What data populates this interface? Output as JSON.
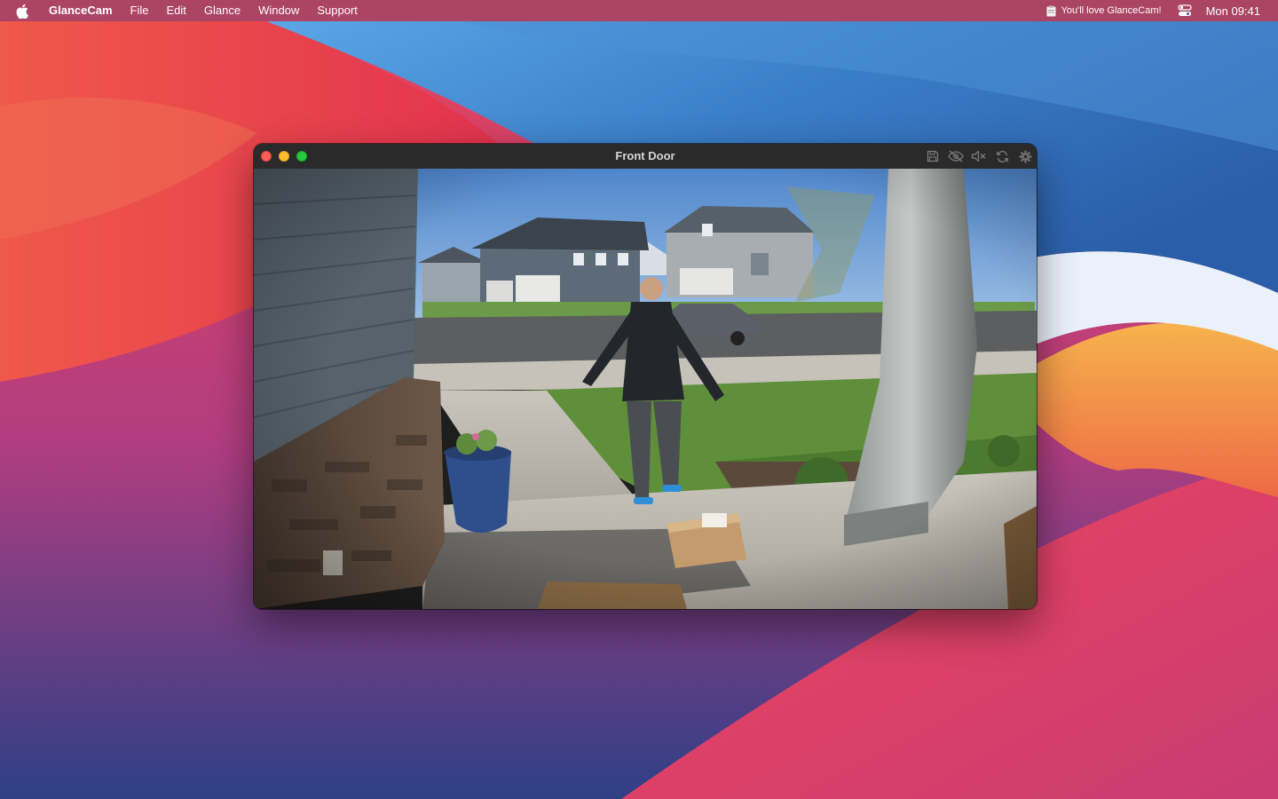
{
  "menubar": {
    "app_name": "GlanceCam",
    "menus": [
      "File",
      "Edit",
      "Glance",
      "Window",
      "Support"
    ],
    "status_text": "You'll love GlanceCam!",
    "clock": "Mon 09:41"
  },
  "window": {
    "title": "Front Door",
    "toolbar_icons": [
      "save-icon",
      "hide-icon",
      "mute-icon",
      "refresh-icon",
      "gear-icon"
    ]
  },
  "camera_feed": {
    "scene_colors": {
      "sky": "#6e9fd8",
      "grass": "#5f8f3a",
      "concrete": "#b9b4ab",
      "house_siding": "#55626c",
      "stone": "#5b4a3d",
      "package": "#c49b6c"
    }
  },
  "colors": {
    "wallpaper_red": "#e0344c",
    "wallpaper_blue": "#2f6bb3",
    "wallpaper_orange": "#f2a24a",
    "titlebar": "#2b2a2b",
    "close": "#ff5f57",
    "minimize": "#febc2e",
    "zoom": "#28c840"
  }
}
